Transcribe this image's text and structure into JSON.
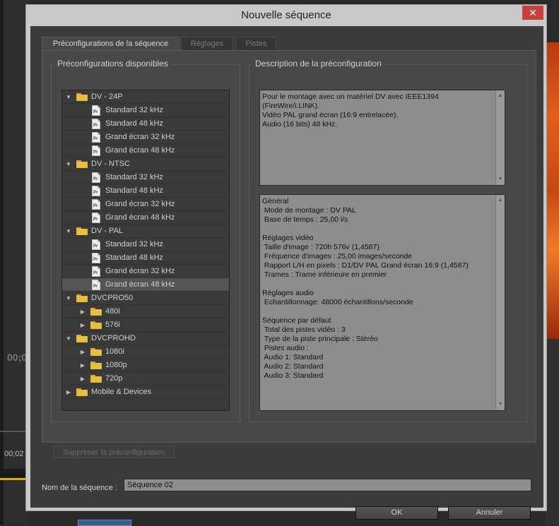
{
  "window": {
    "title": "Nouvelle séquence",
    "close_glyph": "✕"
  },
  "tabs": [
    {
      "label": "Préconfigurations de la séquence",
      "active": true
    },
    {
      "label": "Réglages",
      "active": false
    },
    {
      "label": "Pistes",
      "active": false
    }
  ],
  "presets": {
    "heading": "Préconfigurations disponibles",
    "items": [
      {
        "label": "DV - 24P",
        "level": 0,
        "type": "folder",
        "expanded": true
      },
      {
        "label": "Standard 32 kHz",
        "level": 1,
        "type": "preset"
      },
      {
        "label": "Standard 48 kHz",
        "level": 1,
        "type": "preset"
      },
      {
        "label": "Grand écran 32 kHz",
        "level": 1,
        "type": "preset"
      },
      {
        "label": "Grand écran 48 kHz",
        "level": 1,
        "type": "preset"
      },
      {
        "label": "DV - NTSC",
        "level": 0,
        "type": "folder",
        "expanded": true
      },
      {
        "label": "Standard 32 kHz",
        "level": 1,
        "type": "preset"
      },
      {
        "label": "Standard 48 kHz",
        "level": 1,
        "type": "preset"
      },
      {
        "label": "Grand écran 32 kHz",
        "level": 1,
        "type": "preset"
      },
      {
        "label": "Grand écran 48 kHz",
        "level": 1,
        "type": "preset"
      },
      {
        "label": "DV - PAL",
        "level": 0,
        "type": "folder",
        "expanded": true
      },
      {
        "label": "Standard 32 kHz",
        "level": 1,
        "type": "preset"
      },
      {
        "label": "Standard 48 kHz",
        "level": 1,
        "type": "preset"
      },
      {
        "label": "Grand écran 32 kHz",
        "level": 1,
        "type": "preset"
      },
      {
        "label": "Grand écran 48 kHz",
        "level": 1,
        "type": "preset",
        "selected": true
      },
      {
        "label": "DVCPRO50",
        "level": 0,
        "type": "folder",
        "expanded": true
      },
      {
        "label": "480i",
        "level": 1,
        "type": "folder",
        "expanded": false
      },
      {
        "label": "576i",
        "level": 1,
        "type": "folder",
        "expanded": false
      },
      {
        "label": "DVCPROHD",
        "level": 0,
        "type": "folder",
        "expanded": true
      },
      {
        "label": "1080i",
        "level": 1,
        "type": "folder",
        "expanded": false
      },
      {
        "label": "1080p",
        "level": 1,
        "type": "folder",
        "expanded": false
      },
      {
        "label": "720p",
        "level": 1,
        "type": "folder",
        "expanded": false
      },
      {
        "label": "Mobile & Devices",
        "level": 0,
        "type": "folder",
        "expanded": false
      }
    ]
  },
  "description": {
    "heading": "Description de la préconfiguration",
    "text": "Pour le montage avec un matériel DV avec IEEE1394\n(FireWire/i.LINK).\nVidéo PAL grand écran (16:9 entrelacée).\nAudio (16 bits) 48 kHz.",
    "details": "Général\n Mode de montage : DV PAL\n Base de temps : 25,00 i/s\n\nRéglages vidéo\n Taille d'image : 720h 576v (1,4587)\n Fréquence d'images : 25,00 images/seconde\n Rapport L/H en pixels : D1/DV PAL Grand écran 16:9 (1,4587)\n Trames : Trame inférieure en premier\n\nRéglages audio\n Echantillonnage: 48000 échantillons/seconde\n\nSéquence par défaut\n Total des pistes vidéo : 3\n Type de la piste principale : Stéréo\n Pistes audio :\n Audio 1: Standard\n Audio 2: Standard\n Audio 3: Standard"
  },
  "delete_preset_label": "Supprimer la préconfiguration",
  "sequence_name": {
    "label": "Nom de la séquence :",
    "value": "Séquence 02"
  },
  "buttons": {
    "ok": "OK",
    "cancel": "Annuler"
  },
  "background": {
    "timecode_top": "00;0",
    "timecode_bottom": "00;02"
  },
  "icons": {
    "folder": "folder-icon",
    "preset": "premiere-preset-file-icon",
    "expand": "▼",
    "collapse": "▶"
  }
}
